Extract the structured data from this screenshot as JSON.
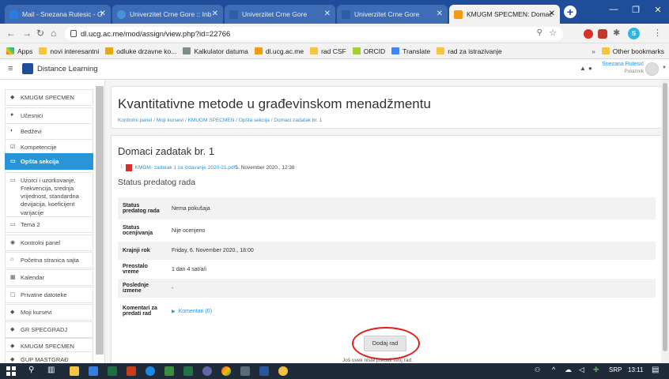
{
  "browser": {
    "tabs": [
      {
        "title": "Mail - Snezana Rutesic - O",
        "active": false,
        "icon_color": "#2c7be5"
      },
      {
        "title": "Univerzitet Crne Gore :: Inb",
        "active": false,
        "icon_color": "#4a90d9"
      },
      {
        "title": "Univerzitet Crne Gore",
        "active": false,
        "icon_color": "#2b5fa8"
      },
      {
        "title": "Univerzitet Crne Gore",
        "active": false,
        "icon_color": "#2b5fa8"
      },
      {
        "title": "KMUGM SPECMEN: Domac",
        "active": true,
        "icon_color": "#f39c12"
      }
    ],
    "url": "dl.ucg.ac.me/mod/assign/view.php?id=22766",
    "profile_initial": "S",
    "bookmarks": [
      {
        "label": "Apps"
      },
      {
        "label": "novi interesantni"
      },
      {
        "label": "odluke drzavne ko..."
      },
      {
        "label": "Kalkulator datuma"
      },
      {
        "label": "dl.ucg.ac.me"
      },
      {
        "label": "rad CSF"
      },
      {
        "label": "ORCID"
      },
      {
        "label": "Translate"
      },
      {
        "label": "rad za istrazivanje"
      }
    ],
    "more_label": "»",
    "other_bookmarks": "Other bookmarks"
  },
  "navbar": {
    "site_name": "Distance Learning",
    "user_name": "Snezana Rutesić",
    "user_role": "Polaznik"
  },
  "sidebar": {
    "items": [
      {
        "label": "KMUGM SPECMEN",
        "icon": "◆"
      },
      {
        "label": "Učesnici",
        "icon": "●"
      },
      {
        "label": "Bedževi",
        "icon": "◐"
      },
      {
        "label": "Kompetencije",
        "icon": "☑"
      },
      {
        "label": "Opšta sekcija",
        "icon": "▭"
      },
      {
        "label": "Uzorci i uzorkovanje, Frekvencija, srednja vrijednost, standardna devijacija, koeficijent varijacije",
        "icon": "▭"
      },
      {
        "label": "Tema 2",
        "icon": "▭"
      },
      {
        "label": "Kontrolni panel",
        "icon": "◉"
      },
      {
        "label": "Početna stranica sajta",
        "icon": "⌂"
      },
      {
        "label": "Kalendar",
        "icon": "▦"
      },
      {
        "label": "Privatne datoteke",
        "icon": "▢"
      },
      {
        "label": "Moji kursevi",
        "icon": "◆"
      },
      {
        "label": "GR SPECGRADJ",
        "icon": "◆"
      },
      {
        "label": "KMUGM SPECMEN",
        "icon": "◆"
      },
      {
        "label": "GUP MASTGRAĐ",
        "icon": "◆"
      }
    ]
  },
  "course": {
    "title": "Kvantitativne metode u građevinskom menadžmentu",
    "breadcrumb": [
      "Kontrolni panel",
      "Moji kursevi",
      "KMUGM SPECMEN",
      "Opšta sekcija",
      "Domaci zadatak br. 1"
    ],
    "separator": "/"
  },
  "assignment": {
    "title": "Domaci zadatak br. 1",
    "file_name": "KMGM- zadatak 1 za izdavanje 2020-21.pdf",
    "file_date": "5. November 2020., 12:38",
    "status_heading": "Status predatog rada",
    "rows": [
      {
        "key": "Status predatog rada",
        "value": "Nema pokušaja"
      },
      {
        "key": "Status ocenjivanja",
        "value": "Nije ocenjeno"
      },
      {
        "key": "Krajnji rok",
        "value": "Friday, 6. November 2020., 18:00"
      },
      {
        "key": "Preostalo vreme",
        "value": "1 dan 4 sat/a/i"
      },
      {
        "key": "Poslednje izmene",
        "value": "-"
      },
      {
        "key": "Komentari za predati rad",
        "value": "Komentari (0)"
      }
    ],
    "add_button": "Dodaj rad",
    "footer_note": "Još uvek niste predali svoj rad."
  },
  "taskbar": {
    "language": "SRP",
    "time": "13:11"
  },
  "colors": {
    "accent": "#2a95d6",
    "tabbar": "#1f4d9a",
    "highlight_circle": "#e0201b"
  }
}
